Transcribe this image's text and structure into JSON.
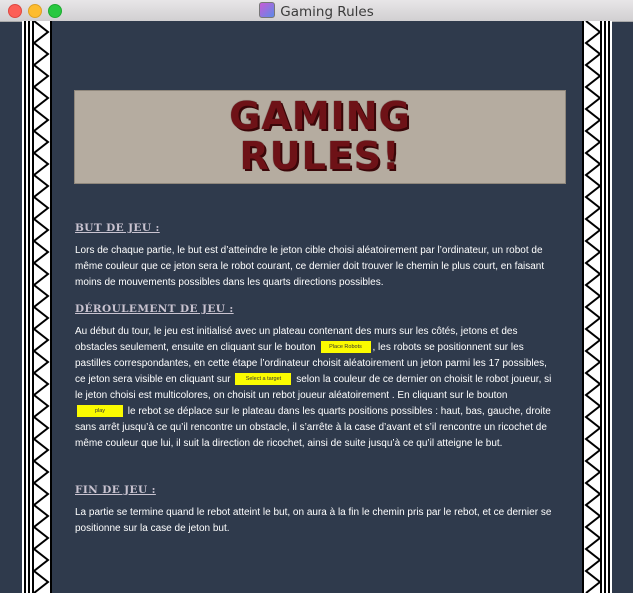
{
  "window": {
    "title": "Gaming Rules"
  },
  "banner": {
    "line1": "GAMING",
    "line2": "RULES!"
  },
  "sections": {
    "but": {
      "title": "BUT DE JEU :",
      "text": "Lors de chaque partie, le but est d’atteindre le jeton cible choisi aléatoirement par l’ordinateur, un robot de même couleur que ce jeton sera le robot courant, ce dernier doit trouver le chemin le plus court, en faisant moins de mouvements possibles dans les quarts directions possibles."
    },
    "deroulement": {
      "title": "DÉROULEMENT DE JEU :",
      "text1": "Au début du tour, le jeu est initialisé avec  un plateau contenant des murs sur les côtés, jetons et des obstacles seulement, ensuite en cliquant sur le bouton",
      "text2": ", les robots se positionnent sur les pastilles correspondantes, en cette étape  l’ordinateur choisit aléatoirement un jeton parmi les 17 possibles, ce jeton sera visible en cliquant sur",
      "text3": "selon la couleur de ce dernier on choisit le robot joueur, si le jeton choisi est multicolores, on choisit un rebot joueur aléatoirement   . En cliquant sur le bouton",
      "text4": "le rebot se déplace sur le plateau dans les quarts positions possibles : haut, bas, gauche, droite sans arrêt jusqu’à ce qu’il rencontre un obstacle, il s’arrête à la case d’avant et s’il rencontre un ricochet de même couleur que lui, il suit la direction de ricochet, ainsi de suite jusqu’à ce qu’il atteigne le but.",
      "btn_place": "Place Robots",
      "btn_target": "Select a target",
      "btn_play": "play"
    },
    "fin": {
      "title": "FIN DE JEU :",
      "text": "La partie se termine quand le rebot atteint le but, on aura à la fin le chemin pris par le rebot, et ce dernier se positionne sur la case de jeton but."
    }
  },
  "colors": {
    "background": "#2f3a4c",
    "button": "#fbfb00",
    "banner_text": "#6e1217"
  },
  "icons": {
    "app": "gaming-rules-app-icon"
  }
}
